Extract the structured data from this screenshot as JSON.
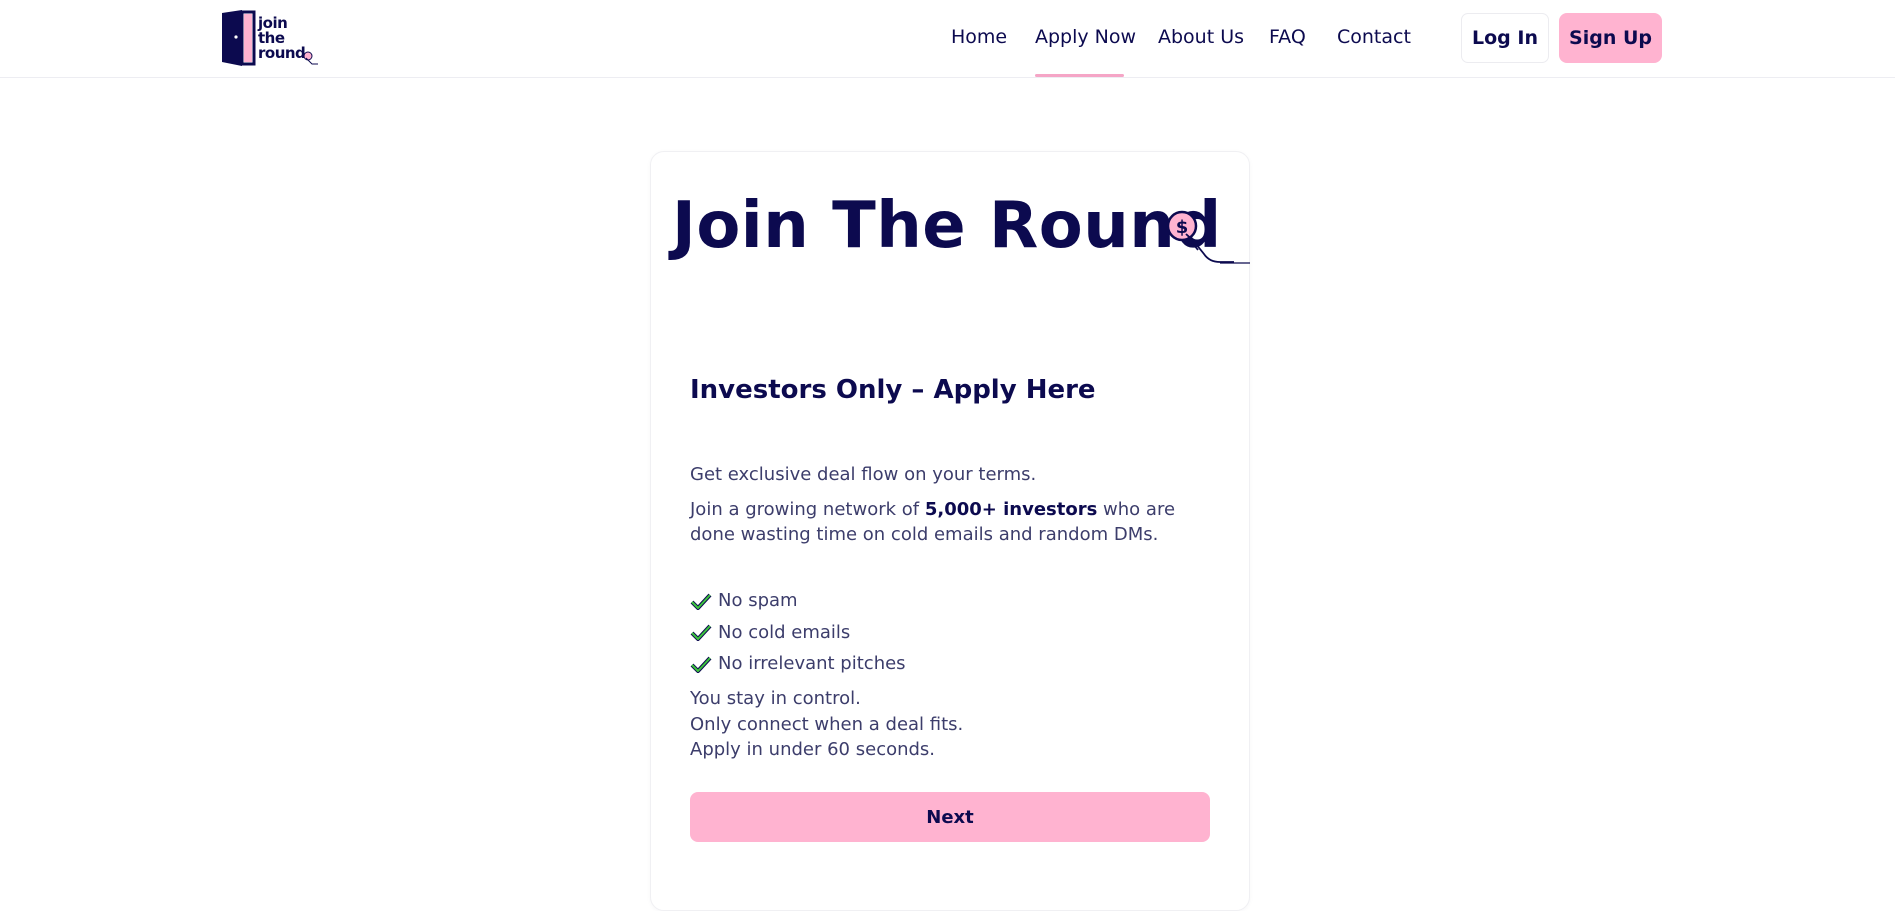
{
  "brand": {
    "logo_line1": "join",
    "logo_line2": "the",
    "logo_line3": "round"
  },
  "nav": {
    "items": [
      {
        "label": "Home"
      },
      {
        "label": "Apply Now",
        "active": true
      },
      {
        "label": "About Us"
      },
      {
        "label": "FAQ"
      },
      {
        "label": "Contact"
      }
    ],
    "login_label": "Log In",
    "signup_label": "Sign Up"
  },
  "hero": {
    "title": "Join The Round"
  },
  "form": {
    "heading": "Investors Only – Apply Here",
    "intro": "Get exclusive deal flow on your terms.",
    "network_prefix": "Join a growing network of ",
    "network_bold": "5,000+ investors",
    "network_suffix": " who are done wasting time on cold emails and random DMs.",
    "checks": [
      "No spam",
      "No cold emails",
      "No irrelevant pitches"
    ],
    "closing": [
      "You stay in control.",
      "Only connect when a deal fits.",
      "Apply in under 60 seconds."
    ],
    "next_label": "Next"
  },
  "colors": {
    "navy": "#0c0a4f",
    "pink": "#ffb3d0",
    "check_green": "#2e9e2e"
  },
  "icons": {
    "logo": "door-logo-icon",
    "hero": "hand-coin-icon",
    "check": "check-icon"
  }
}
